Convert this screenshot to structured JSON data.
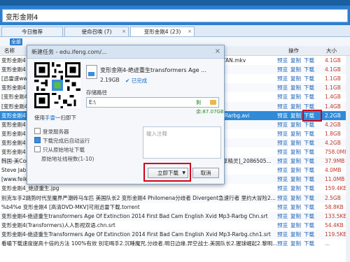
{
  "search": {
    "value": "变形金刚4"
  },
  "tabs": [
    {
      "label": "今日推荐"
    },
    {
      "label": "使命召唤 (7)"
    },
    {
      "label": "变形金刚4 (23)"
    }
  ],
  "filters": [
    "全部"
  ],
  "columns": {
    "name": "名称",
    "ops": "操作",
    "size": "大小"
  },
  "rows": [
    {
      "name": "变形金刚4",
      "tail": "TAN.mkv",
      "size": "4.1GB"
    },
    {
      "name": "变形金刚4",
      "tail": "",
      "size": "4.1GB"
    },
    {
      "name": "[迅雷速www",
      "tail": "",
      "size": "1.1GB"
    },
    {
      "name": "变形金刚4",
      "tail": "",
      "size": "1.1GB"
    },
    {
      "name": "[变形金刚4",
      "tail": "",
      "size": "1.4GB"
    },
    {
      "name": "[变形金刚4",
      "tail": "",
      "size": "1.4GB"
    },
    {
      "name": "变形金刚4",
      "tail": "-Rarbg.avi",
      "size": "2.2GB"
    },
    {
      "name": "变形金刚4",
      "tail": "",
      "size": "4.2GB"
    },
    {
      "name": "变形金刚4",
      "tail": "",
      "size": "1.8GB"
    },
    {
      "name": "变形金刚4",
      "tail": "",
      "size": "4.2GB"
    },
    {
      "name": "变形金刚4",
      "tail": "",
      "size": "758.0MB"
    },
    {
      "name": "韩国-美Cor",
      "tail": "享精灵]_2086505...",
      "size": "37.9MB"
    },
    {
      "name": "Steve Jablonsky - 变形金刚4(绝迹重生) Transformers:Age Of Extinction",
      "tail": "",
      "size": "4.0MB"
    },
    {
      "name": "[www.feikong.tv]变形金刚4 绝迹重生4 灭绝时代预告片.rmvb",
      "tail": "",
      "size": "11.0MB"
    },
    {
      "name": "变形金刚4_绝迹重生.jpg",
      "tail": "",
      "size": "159.4KB"
    },
    {
      "name": "别克车手2跳势时代至魔界严潮砖马车匹 美国队长2 变形金刚4 Philomena分歧者 Divergent急速行者 里约大冒险2...",
      "tail": "",
      "size": "2.5GB"
    },
    {
      "name": "%b4%e 变形金刚4 [高清DVD-MKV]可用迅雷下载.torrent",
      "tail": "",
      "size": "58.8KB"
    },
    {
      "name": "变形金刚4-绝迹重生transformers Age Of Extinction 2014 First Bad Cam English Xvid Mp3-Rarbg Chn.srt",
      "tail": "",
      "size": "133.5KB"
    },
    {
      "name": "变形金刚4(Transformers)人人影视双语.chn.srt",
      "tail": "",
      "size": "54.4KB"
    },
    {
      "name": "变形金刚4-绝迹重生Transformers Age Of Extinction 2014 First Bad Cam English Xvid Mp3-Rarbg.chn1.srt",
      "tail": "",
      "size": "119.5KB"
    },
    {
      "name": "看嗑下载速度提高十倍的方法 100%有效 别宅喝手2.沉睡魔咒.分歧者.明日边缘.异空战士.美国队长2.猩球崛起2.黎明...",
      "tail": "",
      "size": "..."
    }
  ],
  "row_actions": [
    "预览",
    "复制",
    "下载"
  ],
  "dialog": {
    "title": "新建任务 - edu.ifeng.com/...",
    "close": "×",
    "file_name": "变形金刚4-绝迹重生transformers Age ...",
    "file_size": "2.19GB",
    "file_status": "已完成",
    "path_label": "存储路径",
    "path_value": "E:\\",
    "free_space": "剩余:87.07GB",
    "qr_prefix": "使用",
    "qr_link": "手雷",
    "qr_suffix": "一扫即下",
    "options": [
      {
        "label": "登录服务器",
        "checked": false
      },
      {
        "label": "下载完成后自动运行",
        "checked": true
      },
      {
        "label": "只从原始地址下载",
        "checked": false
      },
      {
        "label": "原始地址线程数(1-10)",
        "checked": false
      }
    ],
    "note_placeholder": "输入注释",
    "download_label": "立即下载",
    "cancel_label": "取消"
  },
  "colors": {
    "accent": "#2c7fd0",
    "selected_row": "#2f8ad8",
    "highlight": "#d0021b",
    "size_text": "#c0392b"
  }
}
